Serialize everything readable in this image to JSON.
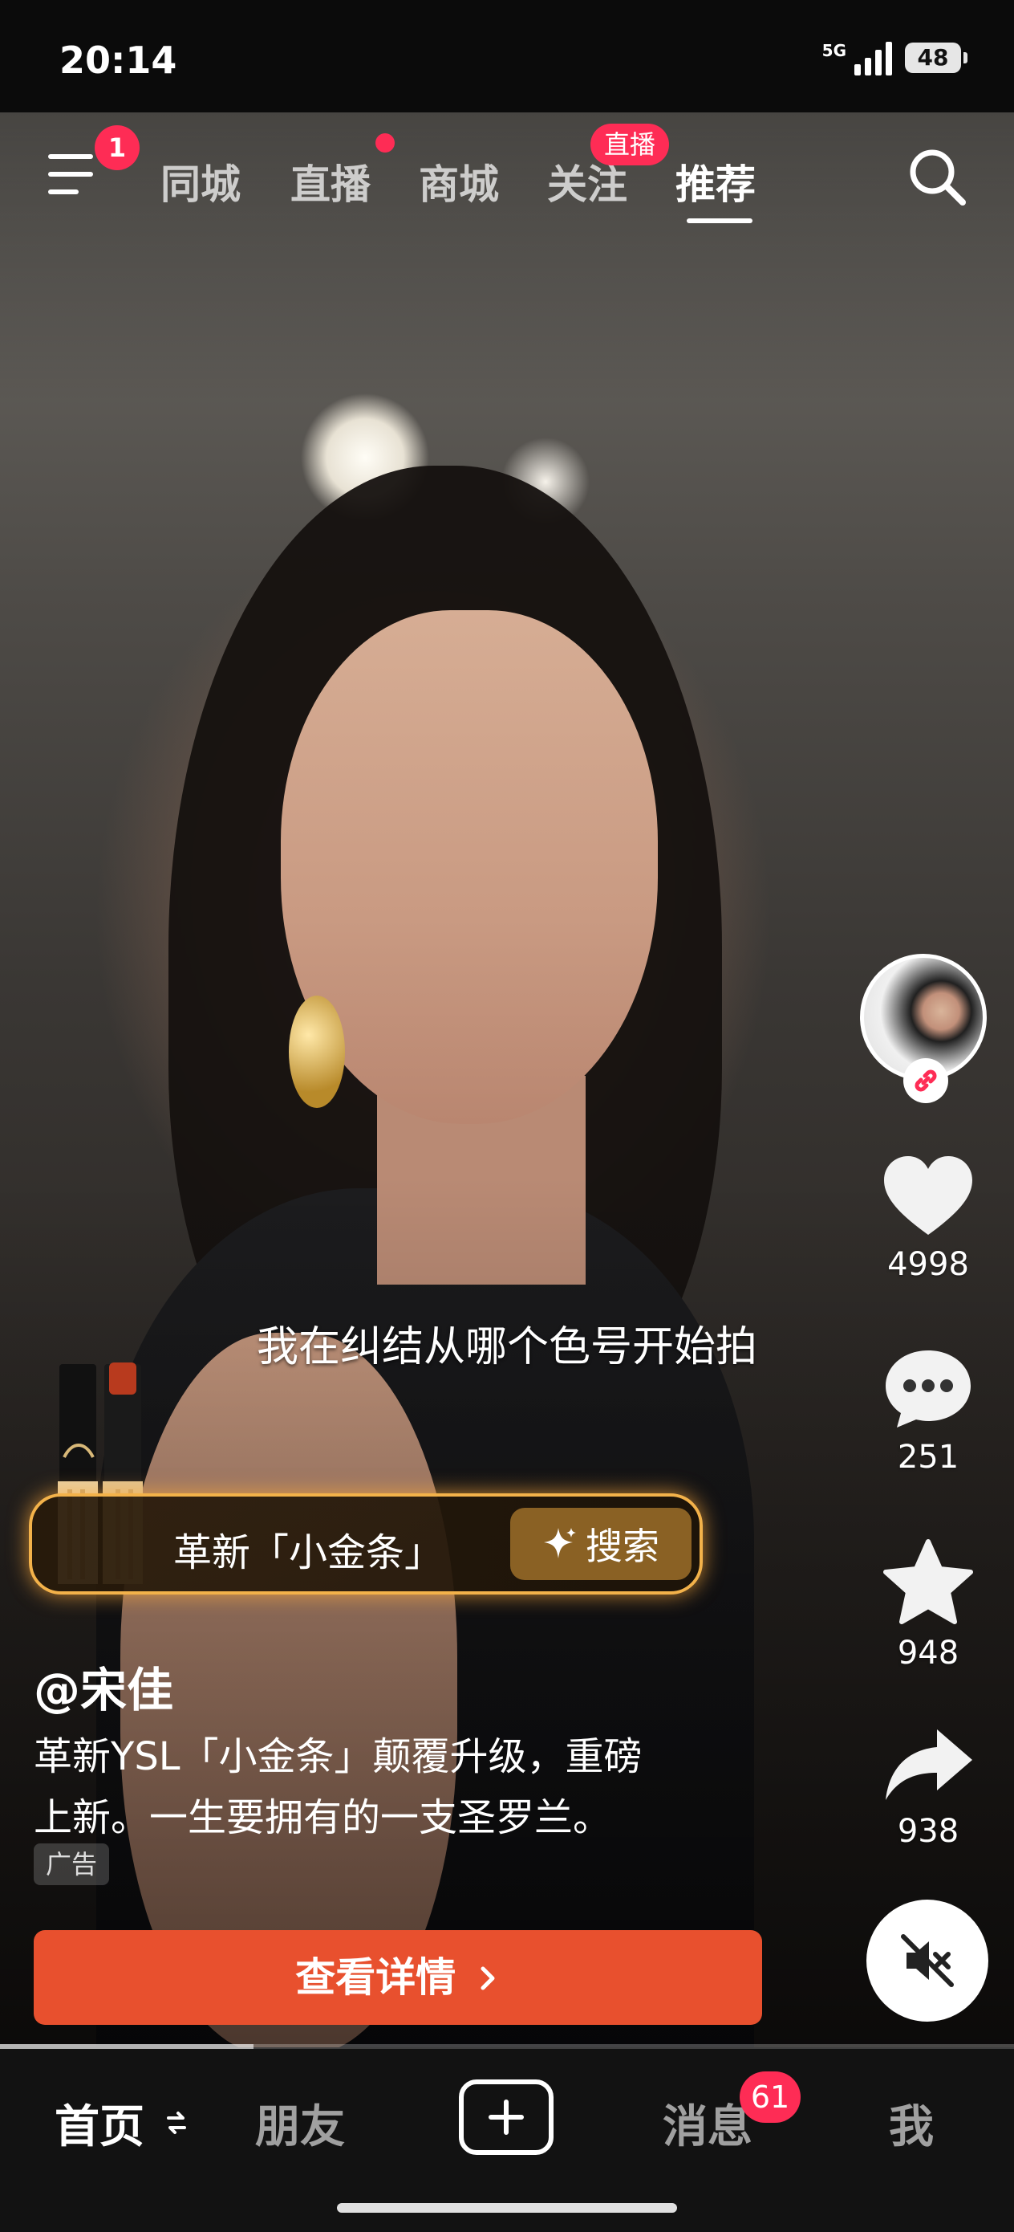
{
  "status_bar": {
    "time": "20:14",
    "network": "5G",
    "battery": "48"
  },
  "top_nav": {
    "menu_badge": "1",
    "tabs": [
      {
        "label": "同城"
      },
      {
        "label": "直播"
      },
      {
        "label": "商城"
      },
      {
        "label": "关注",
        "badge": "直播"
      },
      {
        "label": "推荐"
      }
    ],
    "active_tab": "推荐"
  },
  "video": {
    "subtitle": "我在纠结从哪个色号开始拍"
  },
  "right_rail": {
    "likes": "4998",
    "comments": "251",
    "favorites": "948",
    "shares": "938"
  },
  "product_card": {
    "name": "革新「小金条」",
    "search_label": "搜索"
  },
  "post": {
    "author": "@宋佳",
    "description_line1": "革新YSL「小金条」颠覆升级，重磅",
    "description_line2": "上新。一生要拥有的一支圣罗兰。",
    "ad_tag": "广告",
    "cta_label": "查看详情"
  },
  "playback_progress": 0.25,
  "bottom_nav": {
    "home": "首页",
    "friends": "朋友",
    "messages": "消息",
    "messages_badge": "61",
    "me": "我"
  },
  "colors": {
    "accent_red": "#fe2c55",
    "cta_orange": "#e8502e",
    "product_gold": "#f3b24a"
  }
}
